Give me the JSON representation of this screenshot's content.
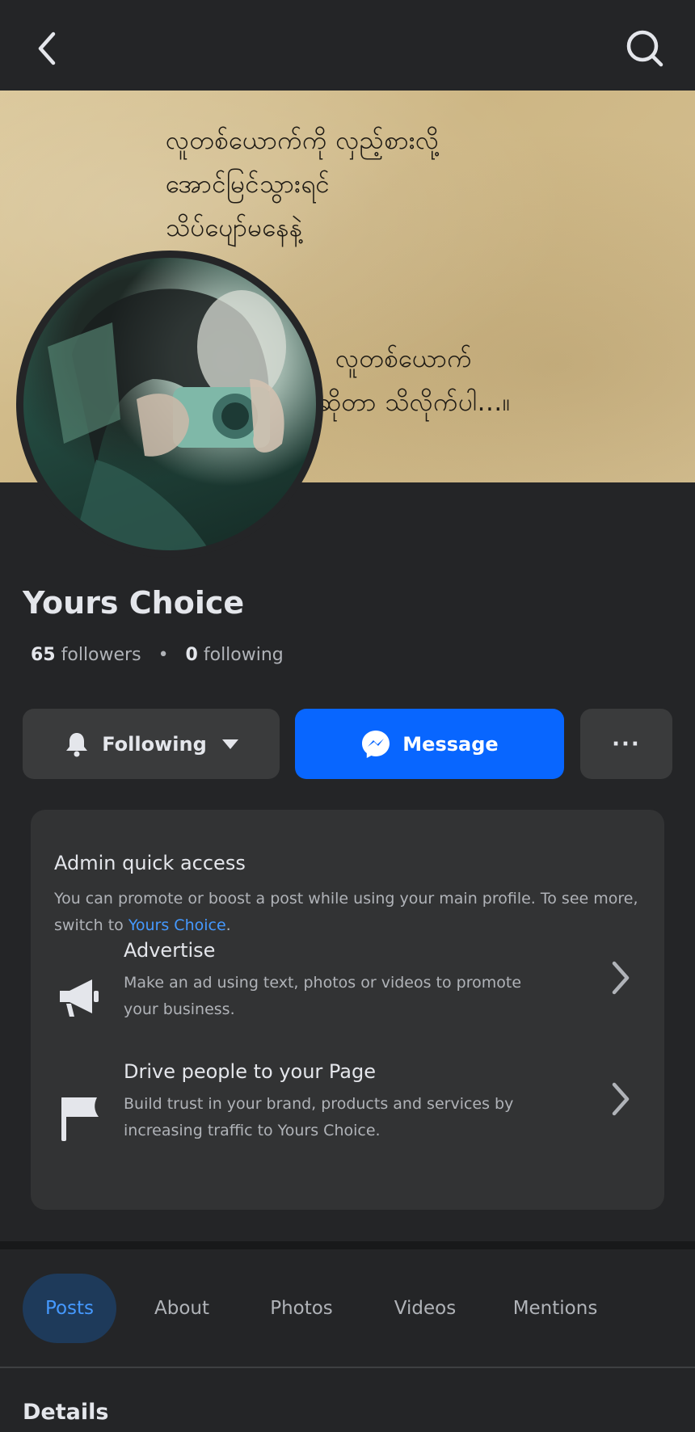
{
  "topbar": {
    "back_icon": "chevron-left-icon",
    "search_icon": "search-icon"
  },
  "cover": {
    "lines": [
      "လူတစ်ယောက်ကို လှည့်စားလို့",
      "အောင်မြင်သွားရင်",
      "သိပ်ပျော်မနေနဲ့",
      "လူတစ်ယောက်",
      "ဆိုတာ သိလိုက်ပါ...။"
    ]
  },
  "profile": {
    "name": "Yours Choice",
    "followers_count": "65",
    "followers_label": "followers",
    "separator": "•",
    "following_count": "0",
    "following_label": "following"
  },
  "actions": {
    "following_label": "Following",
    "message_label": "Message",
    "more_label": "···"
  },
  "admin_card": {
    "title": "Admin quick access",
    "desc_prefix": "You can promote or boost a post while using your main profile. To see more, switch to ",
    "desc_link": "Yours Choice",
    "desc_suffix": ".",
    "rows": [
      {
        "title": "Advertise",
        "desc": "Make an ad using text, photos or videos to promote your business.",
        "icon": "megaphone-icon"
      },
      {
        "title": "Drive people to your Page",
        "desc": "Build trust in your brand, products and services by increasing traffic to Yours Choice.",
        "icon": "flag-icon"
      }
    ]
  },
  "tabs": [
    {
      "label": "Posts",
      "active": true
    },
    {
      "label": "About"
    },
    {
      "label": "Photos"
    },
    {
      "label": "Videos"
    },
    {
      "label": "Mentions"
    }
  ],
  "details": {
    "title": "Details"
  },
  "colors": {
    "background": "#242527",
    "card": "#323334",
    "accent": "#0866ff",
    "link": "#4599ff"
  }
}
